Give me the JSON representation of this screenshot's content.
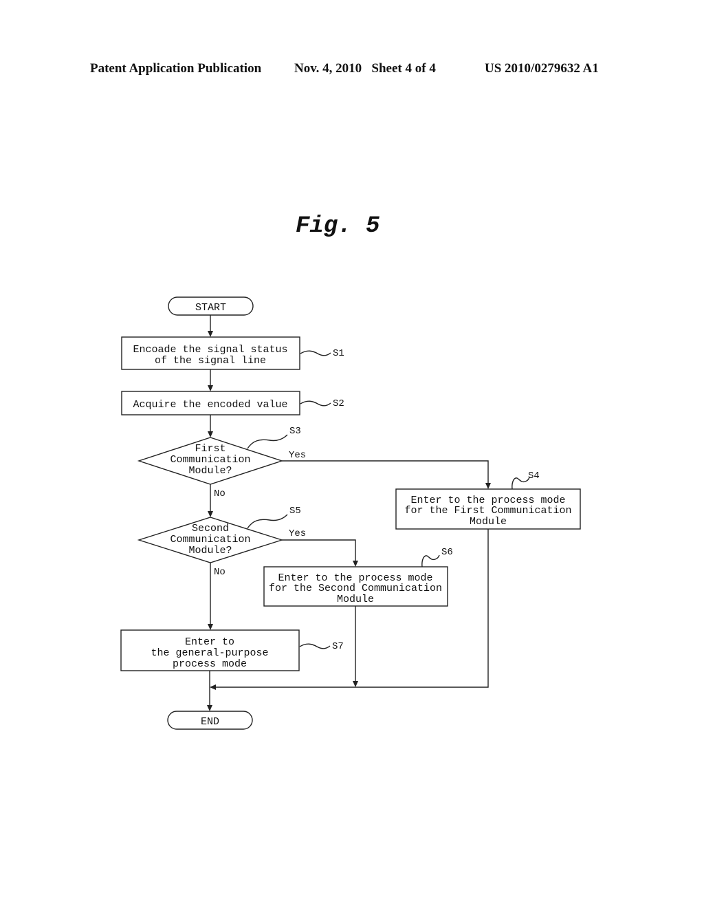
{
  "header": {
    "publication": "Patent Application Publication",
    "date_sheet": "Nov. 4, 2010   Sheet 4 of 4",
    "number": "US 2010/0279632 A1"
  },
  "figure": {
    "title": "Fig. 5",
    "start": "START",
    "end": "END",
    "steps": {
      "s1": {
        "id": "S1",
        "lines": [
          "Encoade the signal status",
          "of the signal line"
        ]
      },
      "s2": {
        "id": "S2",
        "lines": [
          "Acquire the encoded value"
        ]
      },
      "s3": {
        "id": "S3",
        "lines": [
          "First",
          "Communication",
          "Module?"
        ],
        "yes": "Yes",
        "no": "No"
      },
      "s4": {
        "id": "S4",
        "lines": [
          "Enter to the process mode",
          "for the First Communication",
          "Module"
        ]
      },
      "s5": {
        "id": "S5",
        "lines": [
          "Second",
          "Communication",
          "Module?"
        ],
        "yes": "Yes",
        "no": "No"
      },
      "s6": {
        "id": "S6",
        "lines": [
          "Enter to the process mode",
          "for the Second Communication",
          "Module"
        ]
      },
      "s7": {
        "id": "S7",
        "lines": [
          "Enter to",
          "the general-purpose",
          "process mode"
        ]
      }
    }
  }
}
